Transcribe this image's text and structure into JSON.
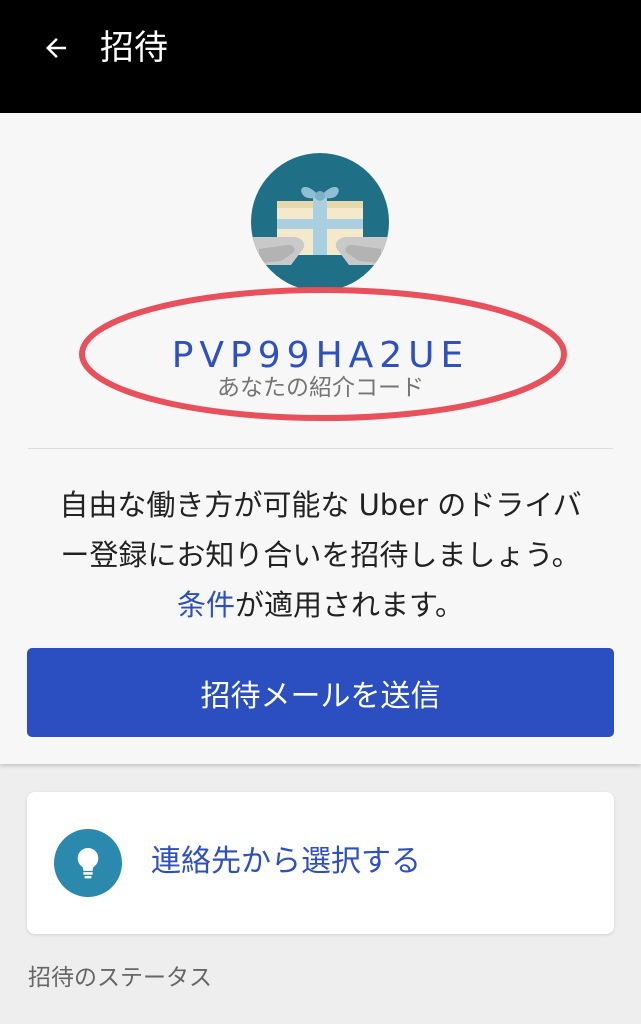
{
  "header": {
    "title": "招待",
    "back_icon": "arrow-left-icon"
  },
  "invite": {
    "illustration_icon": "gift-hands-icon",
    "referral_code": "PVP99HA2UE",
    "referral_code_label": "あなたの紹介コード",
    "description_line1": "自由な働き方が可能な Uber のドライバ",
    "description_line2": "ー登録にお知り合いを招待しましょう。",
    "terms_link": "条件",
    "terms_suffix": "が適用されます。",
    "send_email_button": "招待メールを送信"
  },
  "contacts": {
    "icon": "lightbulb-icon",
    "label": "連絡先から選択する"
  },
  "status": {
    "heading": "招待のステータス"
  },
  "colors": {
    "header_bg": "#000000",
    "accent_blue": "#2b4fc0",
    "highlight_red": "#e8505b",
    "icon_teal": "#2a89ad"
  }
}
